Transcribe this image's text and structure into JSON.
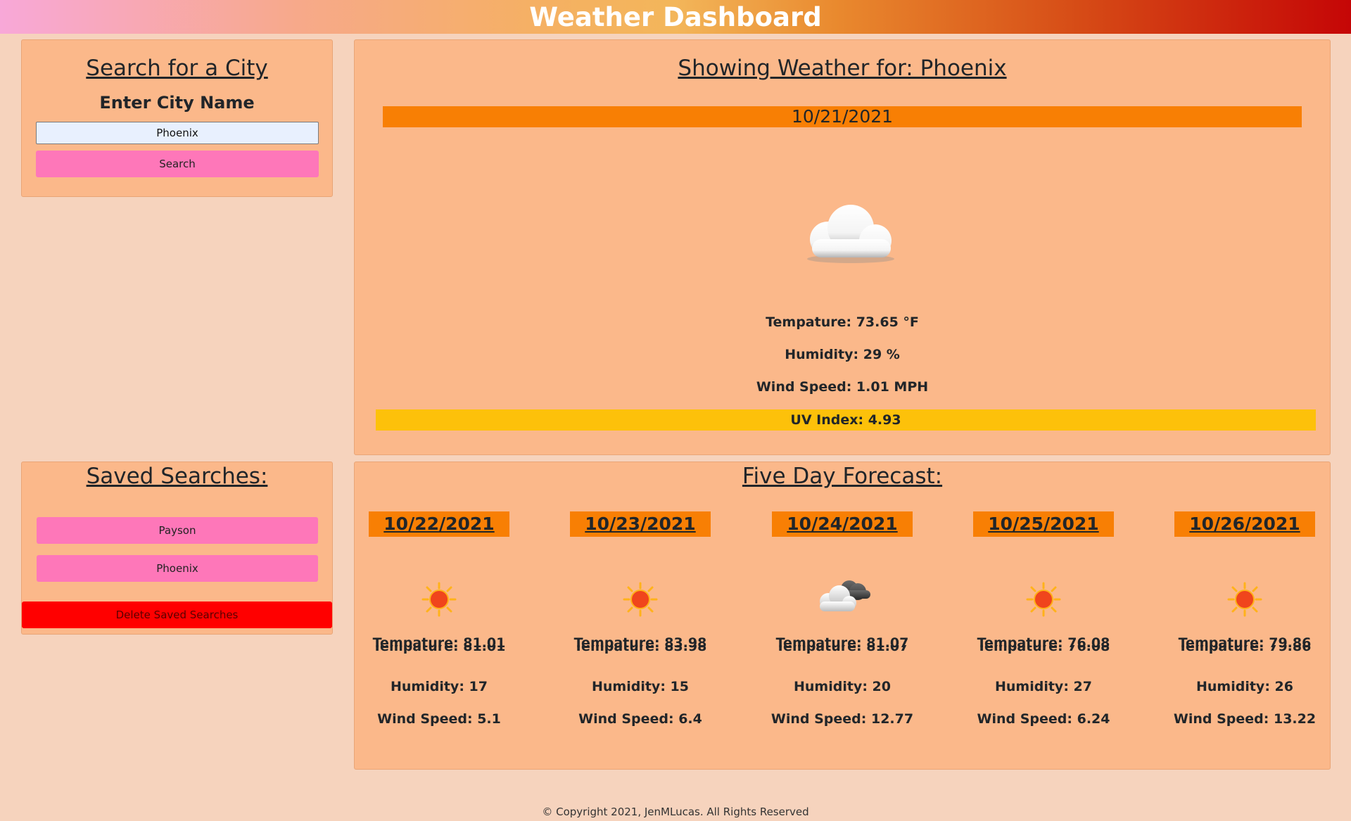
{
  "header": {
    "title": "Weather Dashboard"
  },
  "search": {
    "title": "Search for a City",
    "label": "Enter City Name",
    "input_value": "Phoenix",
    "button_label": "Search"
  },
  "current": {
    "title": "Showing Weather for: Phoenix",
    "date": "10/21/2021",
    "icon": "cloud-icon",
    "temperature": "Tempature: 73.65 °F",
    "humidity": "Humidity: 29 %",
    "wind": "Wind Speed: 1.01 MPH",
    "uv": "UV Index: 4.93"
  },
  "saved": {
    "title": "Saved Searches:",
    "items": [
      "Payson",
      "Phoenix"
    ],
    "delete_label": "Delete Saved Searches"
  },
  "forecast": {
    "title": "Five Day Forecast:",
    "days": [
      {
        "date": "10/22/2021",
        "icon": "sun-icon",
        "temp": "Tempature: 81.01",
        "humidity": "Humidity: 17",
        "wind": "Wind Speed: 5.1"
      },
      {
        "date": "10/23/2021",
        "icon": "sun-icon",
        "temp": "Tempature: 83.98",
        "humidity": "Humidity: 15",
        "wind": "Wind Speed: 6.4"
      },
      {
        "date": "10/24/2021",
        "icon": "partly-cloudy-icon",
        "temp": "Tempature: 81.07",
        "humidity": "Humidity: 20",
        "wind": "Wind Speed: 12.77"
      },
      {
        "date": "10/25/2021",
        "icon": "sun-icon",
        "temp": "Tempature: 76.08",
        "humidity": "Humidity: 27",
        "wind": "Wind Speed: 6.24"
      },
      {
        "date": "10/26/2021",
        "icon": "sun-icon",
        "temp": "Tempature: 79.86",
        "humidity": "Humidity: 26",
        "wind": "Wind Speed: 13.22"
      }
    ]
  },
  "footer": {
    "text": "© Copyright 2021, JenMLucas. All Rights Reserved"
  },
  "colors": {
    "page_bg": "#f6d3bd",
    "panel_bg": "#fbb88a",
    "date_bar": "#f87f04",
    "uv_bar": "#fdc10a",
    "pink_button": "#fe77b9",
    "delete_button": "#ff0000"
  }
}
